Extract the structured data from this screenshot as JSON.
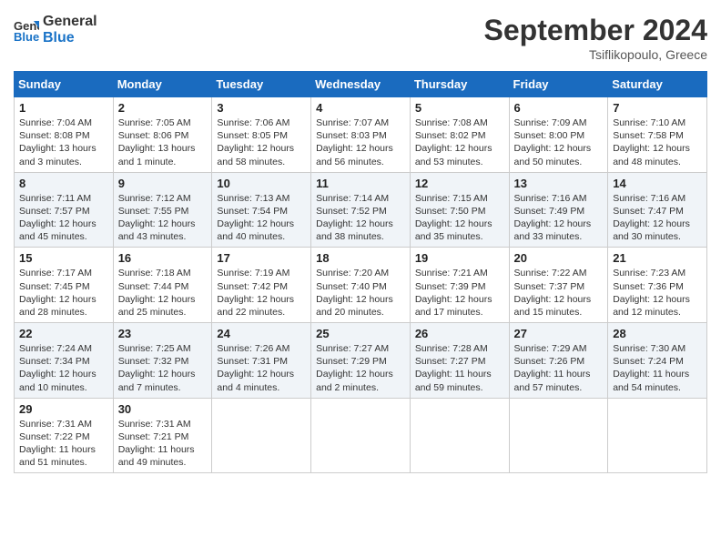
{
  "header": {
    "logo_line1": "General",
    "logo_line2": "Blue",
    "month_title": "September 2024",
    "location": "Tsiflikopoulo, Greece"
  },
  "weekdays": [
    "Sunday",
    "Monday",
    "Tuesday",
    "Wednesday",
    "Thursday",
    "Friday",
    "Saturday"
  ],
  "weeks": [
    [
      {
        "day": "1",
        "info": "Sunrise: 7:04 AM\nSunset: 8:08 PM\nDaylight: 13 hours\nand 3 minutes."
      },
      {
        "day": "2",
        "info": "Sunrise: 7:05 AM\nSunset: 8:06 PM\nDaylight: 13 hours\nand 1 minute."
      },
      {
        "day": "3",
        "info": "Sunrise: 7:06 AM\nSunset: 8:05 PM\nDaylight: 12 hours\nand 58 minutes."
      },
      {
        "day": "4",
        "info": "Sunrise: 7:07 AM\nSunset: 8:03 PM\nDaylight: 12 hours\nand 56 minutes."
      },
      {
        "day": "5",
        "info": "Sunrise: 7:08 AM\nSunset: 8:02 PM\nDaylight: 12 hours\nand 53 minutes."
      },
      {
        "day": "6",
        "info": "Sunrise: 7:09 AM\nSunset: 8:00 PM\nDaylight: 12 hours\nand 50 minutes."
      },
      {
        "day": "7",
        "info": "Sunrise: 7:10 AM\nSunset: 7:58 PM\nDaylight: 12 hours\nand 48 minutes."
      }
    ],
    [
      {
        "day": "8",
        "info": "Sunrise: 7:11 AM\nSunset: 7:57 PM\nDaylight: 12 hours\nand 45 minutes."
      },
      {
        "day": "9",
        "info": "Sunrise: 7:12 AM\nSunset: 7:55 PM\nDaylight: 12 hours\nand 43 minutes."
      },
      {
        "day": "10",
        "info": "Sunrise: 7:13 AM\nSunset: 7:54 PM\nDaylight: 12 hours\nand 40 minutes."
      },
      {
        "day": "11",
        "info": "Sunrise: 7:14 AM\nSunset: 7:52 PM\nDaylight: 12 hours\nand 38 minutes."
      },
      {
        "day": "12",
        "info": "Sunrise: 7:15 AM\nSunset: 7:50 PM\nDaylight: 12 hours\nand 35 minutes."
      },
      {
        "day": "13",
        "info": "Sunrise: 7:16 AM\nSunset: 7:49 PM\nDaylight: 12 hours\nand 33 minutes."
      },
      {
        "day": "14",
        "info": "Sunrise: 7:16 AM\nSunset: 7:47 PM\nDaylight: 12 hours\nand 30 minutes."
      }
    ],
    [
      {
        "day": "15",
        "info": "Sunrise: 7:17 AM\nSunset: 7:45 PM\nDaylight: 12 hours\nand 28 minutes."
      },
      {
        "day": "16",
        "info": "Sunrise: 7:18 AM\nSunset: 7:44 PM\nDaylight: 12 hours\nand 25 minutes."
      },
      {
        "day": "17",
        "info": "Sunrise: 7:19 AM\nSunset: 7:42 PM\nDaylight: 12 hours\nand 22 minutes."
      },
      {
        "day": "18",
        "info": "Sunrise: 7:20 AM\nSunset: 7:40 PM\nDaylight: 12 hours\nand 20 minutes."
      },
      {
        "day": "19",
        "info": "Sunrise: 7:21 AM\nSunset: 7:39 PM\nDaylight: 12 hours\nand 17 minutes."
      },
      {
        "day": "20",
        "info": "Sunrise: 7:22 AM\nSunset: 7:37 PM\nDaylight: 12 hours\nand 15 minutes."
      },
      {
        "day": "21",
        "info": "Sunrise: 7:23 AM\nSunset: 7:36 PM\nDaylight: 12 hours\nand 12 minutes."
      }
    ],
    [
      {
        "day": "22",
        "info": "Sunrise: 7:24 AM\nSunset: 7:34 PM\nDaylight: 12 hours\nand 10 minutes."
      },
      {
        "day": "23",
        "info": "Sunrise: 7:25 AM\nSunset: 7:32 PM\nDaylight: 12 hours\nand 7 minutes."
      },
      {
        "day": "24",
        "info": "Sunrise: 7:26 AM\nSunset: 7:31 PM\nDaylight: 12 hours\nand 4 minutes."
      },
      {
        "day": "25",
        "info": "Sunrise: 7:27 AM\nSunset: 7:29 PM\nDaylight: 12 hours\nand 2 minutes."
      },
      {
        "day": "26",
        "info": "Sunrise: 7:28 AM\nSunset: 7:27 PM\nDaylight: 11 hours\nand 59 minutes."
      },
      {
        "day": "27",
        "info": "Sunrise: 7:29 AM\nSunset: 7:26 PM\nDaylight: 11 hours\nand 57 minutes."
      },
      {
        "day": "28",
        "info": "Sunrise: 7:30 AM\nSunset: 7:24 PM\nDaylight: 11 hours\nand 54 minutes."
      }
    ],
    [
      {
        "day": "29",
        "info": "Sunrise: 7:31 AM\nSunset: 7:22 PM\nDaylight: 11 hours\nand 51 minutes."
      },
      {
        "day": "30",
        "info": "Sunrise: 7:31 AM\nSunset: 7:21 PM\nDaylight: 11 hours\nand 49 minutes."
      },
      {
        "day": "",
        "info": ""
      },
      {
        "day": "",
        "info": ""
      },
      {
        "day": "",
        "info": ""
      },
      {
        "day": "",
        "info": ""
      },
      {
        "day": "",
        "info": ""
      }
    ]
  ]
}
